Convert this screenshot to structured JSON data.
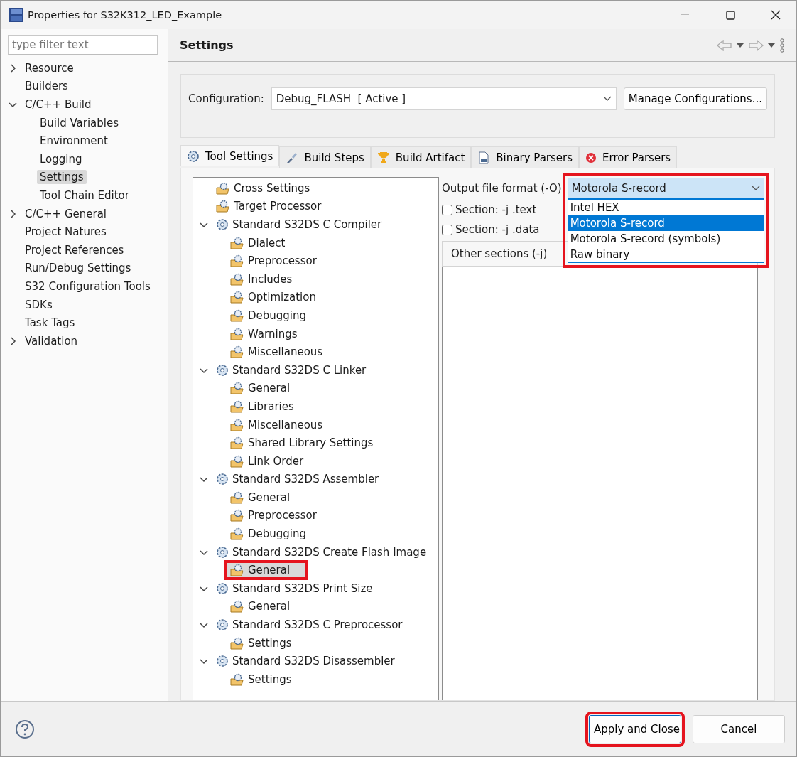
{
  "window": {
    "title": "Properties for S32K312_LED_Example"
  },
  "sidebar": {
    "filter": {
      "placeholder": "type filter text"
    },
    "items": [
      {
        "label": "Resource",
        "expanded": false,
        "selected": false
      },
      {
        "label": "Builders",
        "selected": false
      },
      {
        "label": "C/C++ Build",
        "expanded": true,
        "selected": false,
        "children": [
          {
            "label": "Build Variables",
            "selected": false
          },
          {
            "label": "Environment",
            "selected": false
          },
          {
            "label": "Logging",
            "selected": false
          },
          {
            "label": "Settings",
            "selected": true
          },
          {
            "label": "Tool Chain Editor",
            "selected": false
          }
        ]
      },
      {
        "label": "C/C++ General",
        "expanded": false,
        "selected": false
      },
      {
        "label": "Project Natures",
        "selected": false
      },
      {
        "label": "Project References",
        "selected": false
      },
      {
        "label": "Run/Debug Settings",
        "selected": false
      },
      {
        "label": "S32 Configuration Tools",
        "selected": false
      },
      {
        "label": "SDKs",
        "selected": false
      },
      {
        "label": "Task Tags",
        "selected": false
      },
      {
        "label": "Validation",
        "expanded": false,
        "selected": false
      }
    ]
  },
  "page": {
    "title": "Settings"
  },
  "configuration": {
    "label": "Configuration:",
    "value": "Debug_FLASH  [ Active ]",
    "manage_button": "Manage Configurations..."
  },
  "tabs": [
    {
      "label": "Tool Settings",
      "kind": "gear",
      "selected": true
    },
    {
      "label": "Build Steps",
      "kind": "brush",
      "selected": false
    },
    {
      "label": "Build Artifact",
      "kind": "trophy",
      "selected": false
    },
    {
      "label": "Binary Parsers",
      "kind": "binary",
      "selected": false
    },
    {
      "label": "Error Parsers",
      "kind": "error",
      "selected": false
    }
  ],
  "tool_tree": [
    {
      "label": "Cross Settings",
      "kind": "option",
      "selected": false,
      "highlighted": false
    },
    {
      "label": "Target Processor",
      "kind": "option",
      "selected": false,
      "highlighted": false
    },
    {
      "label": "Standard S32DS C Compiler",
      "kind": "tool",
      "expanded": true,
      "children": [
        {
          "label": "Dialect",
          "kind": "option",
          "selected": false,
          "highlighted": false
        },
        {
          "label": "Preprocessor",
          "kind": "option",
          "selected": false,
          "highlighted": false
        },
        {
          "label": "Includes",
          "kind": "option",
          "selected": false,
          "highlighted": false
        },
        {
          "label": "Optimization",
          "kind": "option",
          "selected": false,
          "highlighted": false
        },
        {
          "label": "Debugging",
          "kind": "option",
          "selected": false,
          "highlighted": false
        },
        {
          "label": "Warnings",
          "kind": "option",
          "selected": false,
          "highlighted": false
        },
        {
          "label": "Miscellaneous",
          "kind": "option",
          "selected": false,
          "highlighted": false
        }
      ]
    },
    {
      "label": "Standard S32DS C Linker",
      "kind": "tool",
      "expanded": true,
      "children": [
        {
          "label": "General",
          "kind": "option",
          "selected": false,
          "highlighted": false
        },
        {
          "label": "Libraries",
          "kind": "option",
          "selected": false,
          "highlighted": false
        },
        {
          "label": "Miscellaneous",
          "kind": "option",
          "selected": false,
          "highlighted": false
        },
        {
          "label": "Shared Library Settings",
          "kind": "option",
          "selected": false,
          "highlighted": false
        },
        {
          "label": "Link Order",
          "kind": "option",
          "selected": false,
          "highlighted": false
        }
      ]
    },
    {
      "label": "Standard S32DS Assembler",
      "kind": "tool",
      "expanded": true,
      "children": [
        {
          "label": "General",
          "kind": "option",
          "selected": false,
          "highlighted": false
        },
        {
          "label": "Preprocessor",
          "kind": "option",
          "selected": false,
          "highlighted": false
        },
        {
          "label": "Debugging",
          "kind": "option",
          "selected": false,
          "highlighted": false
        }
      ]
    },
    {
      "label": "Standard S32DS Create Flash Image",
      "kind": "tool",
      "expanded": true,
      "children": [
        {
          "label": "General",
          "kind": "option",
          "selected": true,
          "highlighted": true
        }
      ]
    },
    {
      "label": "Standard S32DS Print Size",
      "kind": "tool",
      "expanded": true,
      "children": [
        {
          "label": "General",
          "kind": "option",
          "selected": false,
          "highlighted": false
        }
      ]
    },
    {
      "label": "Standard S32DS C Preprocessor",
      "kind": "tool",
      "expanded": true,
      "children": [
        {
          "label": "Settings",
          "kind": "option",
          "selected": false,
          "highlighted": false
        }
      ]
    },
    {
      "label": "Standard S32DS Disassembler",
      "kind": "tool",
      "expanded": true,
      "children": [
        {
          "label": "Settings",
          "kind": "option",
          "selected": false,
          "highlighted": false
        }
      ]
    }
  ],
  "output_format": {
    "label": "Output file format (-O)",
    "value": "Motorola S-record",
    "open": true,
    "highlighted": true,
    "options": [
      {
        "label": "Intel HEX",
        "selected": false
      },
      {
        "label": "Motorola S-record",
        "selected": true
      },
      {
        "label": "Motorola S-record (symbols)",
        "selected": false
      },
      {
        "label": "Raw binary",
        "selected": false
      }
    ]
  },
  "sections": [
    {
      "label": "Section: -j .text",
      "checked": false
    },
    {
      "label": "Section: -j .data",
      "checked": false
    }
  ],
  "other_sections": {
    "heading": "Other sections (-j)"
  },
  "footer": {
    "buttons": [
      {
        "label": "Apply and Close",
        "kind": "primary",
        "highlighted": true
      },
      {
        "label": "Cancel",
        "kind": "secondary",
        "highlighted": false
      }
    ]
  }
}
